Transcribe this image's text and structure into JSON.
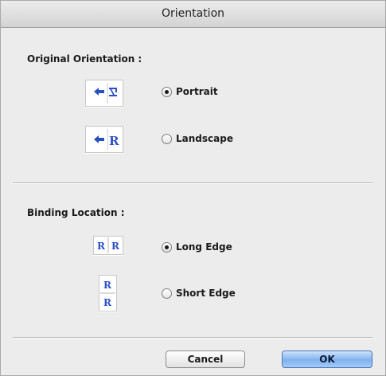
{
  "window": {
    "title": "Orientation"
  },
  "original_orientation": {
    "label": "Original Orientation :",
    "options": [
      {
        "label": "Portrait",
        "checked": true,
        "icon": "portrait-orientation-icon"
      },
      {
        "label": "Landscape",
        "checked": false,
        "icon": "landscape-orientation-icon"
      }
    ]
  },
  "binding_location": {
    "label": "Binding Location :",
    "options": [
      {
        "label": "Long Edge",
        "checked": true,
        "icon": "long-edge-binding-icon"
      },
      {
        "label": "Short Edge",
        "checked": false,
        "icon": "short-edge-binding-icon"
      }
    ]
  },
  "buttons": {
    "cancel_label": "Cancel",
    "ok_label": "OK"
  },
  "colors": {
    "icon_blue": "#2b4fc4",
    "ok_button": "#7fb2ee"
  }
}
